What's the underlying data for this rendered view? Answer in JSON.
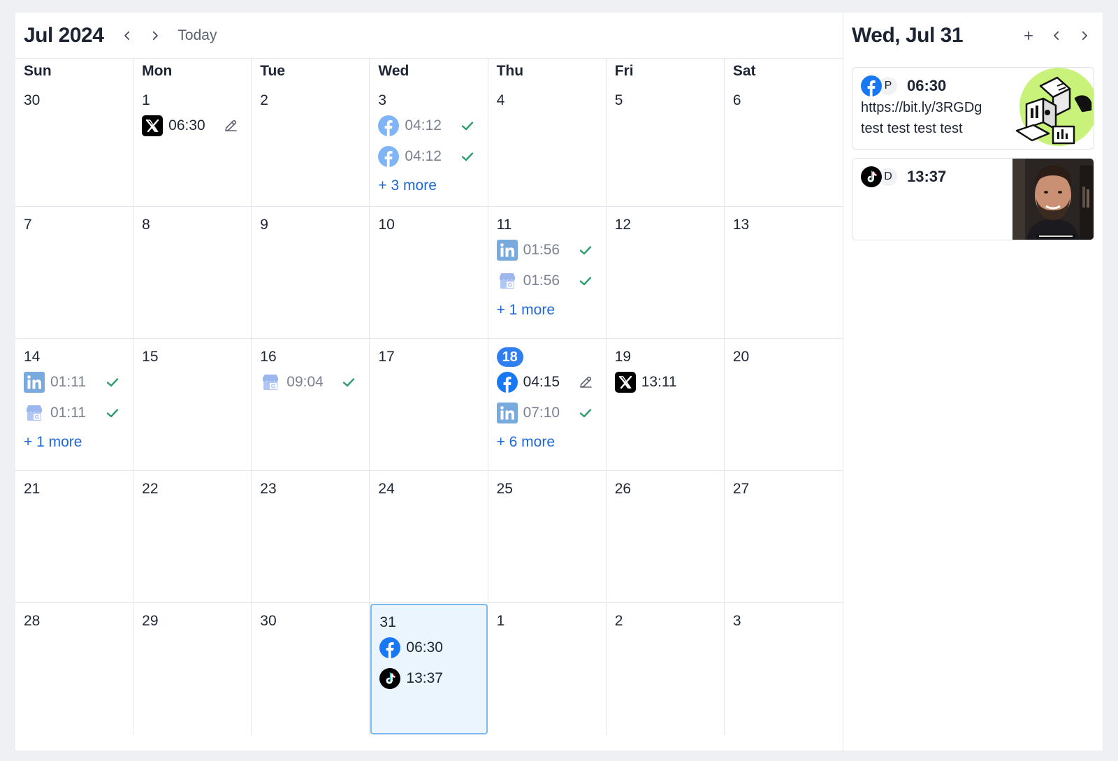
{
  "header": {
    "month_title": "Jul 2024",
    "today_label": "Today"
  },
  "weekdays": [
    "Sun",
    "Mon",
    "Tue",
    "Wed",
    "Thu",
    "Fri",
    "Sat"
  ],
  "weeks": [
    [
      {
        "day": "30",
        "posts": []
      },
      {
        "day": "1",
        "posts": [
          {
            "network": "x",
            "time": "06:30",
            "status": "draft"
          }
        ]
      },
      {
        "day": "2",
        "posts": []
      },
      {
        "day": "3",
        "posts": [
          {
            "network": "facebook",
            "time": "04:12",
            "status": "published"
          },
          {
            "network": "facebook",
            "time": "04:12",
            "status": "published"
          }
        ],
        "more": "+ 3 more"
      },
      {
        "day": "4",
        "posts": []
      },
      {
        "day": "5",
        "posts": []
      },
      {
        "day": "6",
        "posts": []
      }
    ],
    [
      {
        "day": "7",
        "posts": []
      },
      {
        "day": "8",
        "posts": []
      },
      {
        "day": "9",
        "posts": []
      },
      {
        "day": "10",
        "posts": []
      },
      {
        "day": "11",
        "posts": [
          {
            "network": "linkedin",
            "time": "01:56",
            "status": "published"
          },
          {
            "network": "google-business",
            "time": "01:56",
            "status": "published"
          }
        ],
        "more": "+ 1 more"
      },
      {
        "day": "12",
        "posts": []
      },
      {
        "day": "13",
        "posts": []
      }
    ],
    [
      {
        "day": "14",
        "posts": [
          {
            "network": "linkedin",
            "time": "01:11",
            "status": "published"
          },
          {
            "network": "google-business",
            "time": "01:11",
            "status": "published"
          }
        ],
        "more": "+ 1 more"
      },
      {
        "day": "15",
        "posts": []
      },
      {
        "day": "16",
        "posts": [
          {
            "network": "google-business",
            "time": "09:04",
            "status": "published"
          }
        ]
      },
      {
        "day": "17",
        "posts": []
      },
      {
        "day": "18",
        "today": true,
        "posts": [
          {
            "network": "facebook",
            "time": "04:15",
            "status": "draft"
          },
          {
            "network": "linkedin",
            "time": "07:10",
            "status": "published"
          }
        ],
        "more": "+ 6 more"
      },
      {
        "day": "19",
        "posts": [
          {
            "network": "x",
            "time": "13:11",
            "status": "scheduled"
          }
        ]
      },
      {
        "day": "20",
        "posts": []
      }
    ],
    [
      {
        "day": "21",
        "posts": []
      },
      {
        "day": "22",
        "posts": []
      },
      {
        "day": "23",
        "posts": []
      },
      {
        "day": "24",
        "posts": []
      },
      {
        "day": "25",
        "posts": []
      },
      {
        "day": "26",
        "posts": []
      },
      {
        "day": "27",
        "posts": []
      }
    ],
    [
      {
        "day": "28",
        "posts": []
      },
      {
        "day": "29",
        "posts": []
      },
      {
        "day": "30",
        "posts": []
      },
      {
        "day": "31",
        "selected": true,
        "posts": [
          {
            "network": "facebook",
            "time": "06:30",
            "status": "scheduled"
          },
          {
            "network": "tiktok",
            "time": "13:37",
            "status": "scheduled"
          }
        ]
      },
      {
        "day": "1",
        "posts": []
      },
      {
        "day": "2",
        "posts": []
      },
      {
        "day": "3",
        "posts": []
      }
    ]
  ],
  "sidebar": {
    "title": "Wed, Jul 31",
    "cards": [
      {
        "network": "facebook",
        "account_initial": "P",
        "time": "06:30",
        "text_lines": [
          "https://bit.ly/3RGDg",
          "test test test test"
        ],
        "thumbnail": "illustration-green"
      },
      {
        "network": "tiktok",
        "account_initial": "D",
        "time": "13:37",
        "text_lines": [],
        "thumbnail": "video-man-portrait"
      }
    ]
  },
  "colors": {
    "accent": "#2f7ef2",
    "link": "#1e67d5",
    "check": "#2e9e6b",
    "selected_bg": "#eaf5fd",
    "facebook": "#1877f2",
    "linkedin": "#0a66c2"
  }
}
